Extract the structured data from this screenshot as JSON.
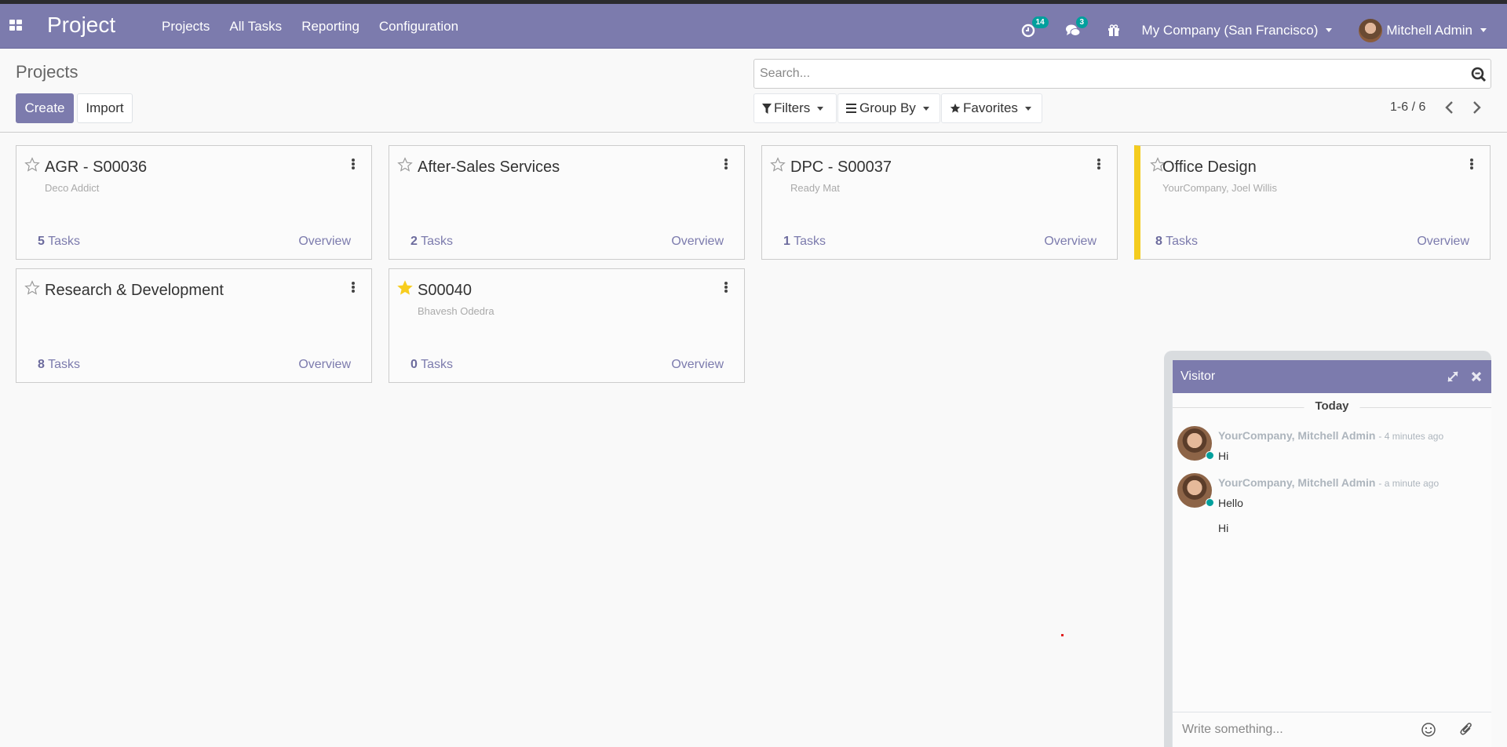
{
  "navbar": {
    "app_title": "Project",
    "menu": [
      {
        "label": "Projects"
      },
      {
        "label": "All Tasks"
      },
      {
        "label": "Reporting"
      },
      {
        "label": "Configuration"
      }
    ],
    "activity_badge": "14",
    "messages_badge": "3",
    "company": "My Company (San Francisco)",
    "user": "Mitchell Admin"
  },
  "control_panel": {
    "title": "Projects",
    "create_label": "Create",
    "import_label": "Import",
    "search_placeholder": "Search...",
    "filters_label": "Filters",
    "group_by_label": "Group By",
    "favorites_label": "Favorites",
    "pager": "1-6 / 6"
  },
  "projects": [
    {
      "name": "AGR - S00036",
      "partner": "Deco Addict",
      "task_count": "5",
      "tasks_label": "Tasks",
      "overview_label": "Overview",
      "favorite": false,
      "color": "none"
    },
    {
      "name": "After-Sales Services",
      "partner": "",
      "task_count": "2",
      "tasks_label": "Tasks",
      "overview_label": "Overview",
      "favorite": false,
      "color": "none"
    },
    {
      "name": "DPC - S00037",
      "partner": "Ready Mat",
      "task_count": "1",
      "tasks_label": "Tasks",
      "overview_label": "Overview",
      "favorite": false,
      "color": "none"
    },
    {
      "name": "Office Design",
      "partner": "YourCompany, Joel Willis",
      "task_count": "8",
      "tasks_label": "Tasks",
      "overview_label": "Overview",
      "favorite": false,
      "color": "#f4cc1f"
    },
    {
      "name": "Research & Development",
      "partner": "",
      "task_count": "8",
      "tasks_label": "Tasks",
      "overview_label": "Overview",
      "favorite": false,
      "color": "none"
    },
    {
      "name": "S00040",
      "partner": "Bhavesh Odedra",
      "task_count": "0",
      "tasks_label": "Tasks",
      "overview_label": "Overview",
      "favorite": true,
      "color": "none"
    }
  ],
  "chat": {
    "title": "Visitor",
    "day_separator": "Today",
    "messages": [
      {
        "author": "YourCompany, Mitchell Admin",
        "date": "- 4 minutes ago",
        "body": "Hi"
      },
      {
        "author": "YourCompany, Mitchell Admin",
        "date": "- a minute ago",
        "body": "Hello",
        "extra": "Hi"
      }
    ],
    "composer_placeholder": "Write something..."
  },
  "colors": {
    "brand": "#7c7bad",
    "badge": "#00a09d",
    "favorite_star": "#f7cd1f",
    "card_color_stripe": "#f4cc1f"
  }
}
